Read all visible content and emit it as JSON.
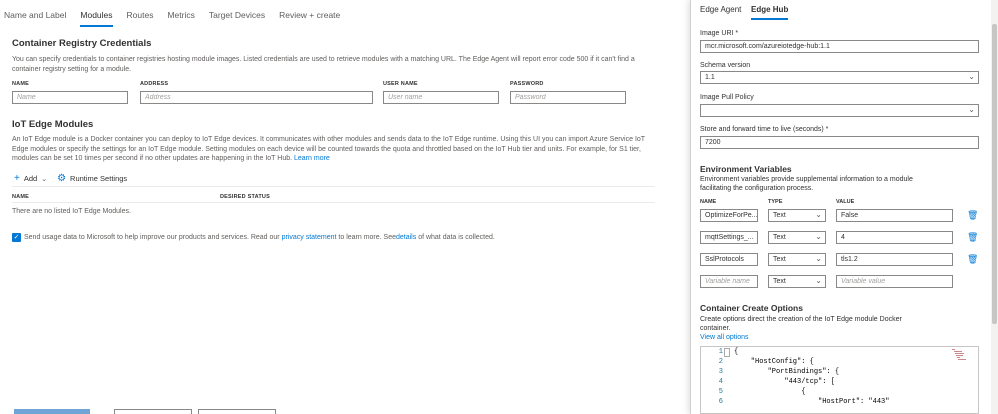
{
  "tabs": [
    "Name and Label",
    "Modules",
    "Routes",
    "Metrics",
    "Target Devices",
    "Review + create"
  ],
  "active_tab": "Modules",
  "registry": {
    "title": "Container Registry Credentials",
    "description": "You can specify credentials to container registries hosting module images. Listed credentials are used to retrieve modules with a matching URL. The Edge Agent will report error code 500 if it can't find a container registry setting for a module.",
    "columns": [
      "NAME",
      "ADDRESS",
      "USER NAME",
      "PASSWORD"
    ],
    "placeholders": [
      "Name",
      "Address",
      "User name",
      "Password"
    ]
  },
  "modules": {
    "title": "IoT Edge Modules",
    "description": "An IoT Edge module is a Docker container you can deploy to IoT Edge devices. It communicates with other modules and sends data to the IoT Edge runtime. Using this UI you can import Azure Service IoT Edge modules or specify the settings for an IoT Edge module. Setting modules on each device will be counted towards the quota and throttled based on the IoT Hub tier and units. For example, for S1 tier, modules can be set 10 times per second if no other updates are happening in the IoT Hub.",
    "learn_more": "Learn more",
    "add_label": "Add",
    "runtime_label": "Runtime Settings",
    "col_name": "NAME",
    "col_status": "DESIRED STATUS",
    "empty_text": "There are no listed IoT Edge Modules."
  },
  "telemetry": {
    "text_1": "Send usage data to Microsoft to help improve our products and services. Read our",
    "link_1": "privacy statement",
    "text_2": "to learn more. See",
    "link_2": "details",
    "text_3": "of what data is collected.",
    "checked": true
  },
  "panel": {
    "tabs": [
      "Edge Agent",
      "Edge Hub"
    ],
    "active_tab": "Edge Hub",
    "image_uri_label": "Image URI *",
    "image_uri": "mcr.microsoft.com/azureiotedge-hub:1.1",
    "schema_label": "Schema version",
    "schema_value": "1.1",
    "pull_policy_label": "Image Pull Policy",
    "pull_policy_value": "",
    "ttl_label": "Store and forward time to live (seconds) *",
    "ttl_value": "7200",
    "env_title": "Environment Variables",
    "env_desc": "Environment variables provide supplemental information to a module facilitating the configuration process.",
    "env_cols": [
      "NAME",
      "TYPE",
      "VALUE"
    ],
    "env_rows": [
      {
        "name": "OptimizeForPe...",
        "type": "Text",
        "value": "False"
      },
      {
        "name": "mqttSettings_...",
        "type": "Text",
        "value": "4"
      },
      {
        "name": "SslProtocols",
        "type": "Text",
        "value": "tls1.2"
      }
    ],
    "env_placeholder_name": "Variable name",
    "env_placeholder_type": "Text",
    "env_placeholder_value": "Variable value",
    "cco_title": "Container Create Options",
    "cco_desc": "Create options direct the creation of the IoT Edge module Docker container.",
    "cco_link": "View all options",
    "code_lines": [
      {
        "n": "1",
        "text": "{"
      },
      {
        "n": "2",
        "text": "    \"HostConfig\": {"
      },
      {
        "n": "3",
        "text": "        \"PortBindings\": {"
      },
      {
        "n": "4",
        "text": "            \"443/tcp\": ["
      },
      {
        "n": "5",
        "text": "                {"
      },
      {
        "n": "6",
        "text": "                    \"HostPort\": \"443\""
      }
    ]
  },
  "colors": {
    "accent": "#0078d4",
    "text": "#323130",
    "muted": "#605e5c",
    "border": "#8a8886"
  }
}
